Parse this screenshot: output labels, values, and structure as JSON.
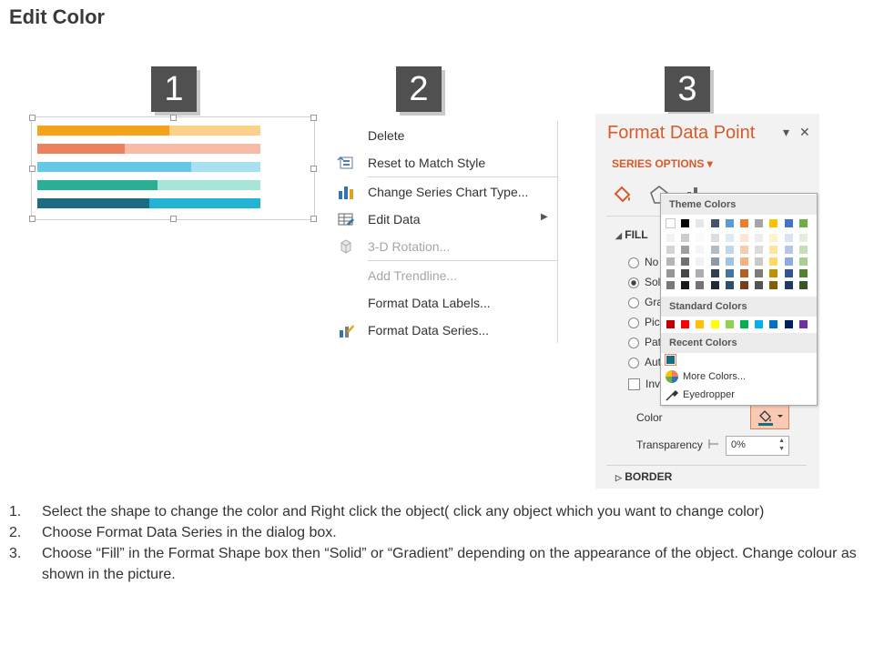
{
  "page": {
    "title": "Edit Color"
  },
  "steps": [
    "1",
    "2",
    "3"
  ],
  "chart_preview": {
    "bars": [
      {
        "light": "#fdd288",
        "dark": "#f4a21c",
        "fill": 0.59
      },
      {
        "light": "#f7bca8",
        "dark": "#e8825f",
        "fill": 0.39
      },
      {
        "light": "#a7e1f1",
        "dark": "#63c9e6",
        "fill": 0.69
      },
      {
        "light": "#a6e5d8",
        "dark": "#2aaf95",
        "fill": 0.54
      },
      {
        "light": "#22b4d5",
        "dark": "#1b6c80",
        "fill": 0.5
      }
    ]
  },
  "context_menu": {
    "items": [
      {
        "label": "Delete",
        "icon": "none",
        "disabled": false
      },
      {
        "label": "Reset to Match Style",
        "icon": "reset-style-icon",
        "disabled": false
      },
      {
        "label": "Change Series Chart Type...",
        "icon": "bar-chart-icon",
        "disabled": false
      },
      {
        "label": "Edit Data",
        "icon": "table-edit-icon",
        "disabled": false,
        "submenu": true
      },
      {
        "label": "3-D Rotation...",
        "icon": "cube-icon",
        "disabled": true
      },
      {
        "label": "Add Trendline...",
        "icon": "none",
        "disabled": true
      },
      {
        "label": "Format Data Labels...",
        "icon": "none",
        "disabled": false
      },
      {
        "label": "Format Data Series...",
        "icon": "format-series-icon",
        "disabled": false
      }
    ]
  },
  "format_pane": {
    "title": "Format Data Point",
    "series_options": "SERIES OPTIONS",
    "fill_section": "FILL",
    "fill_options": [
      "No",
      "Soli",
      "Gra",
      "Pict",
      "Pat",
      "Aut"
    ],
    "selected_fill": 1,
    "invert_label": "Inve",
    "color_label": "Color",
    "transparency_label": "Transparency",
    "transparency_value": "0%",
    "border_section": "BORDER"
  },
  "color_dropdown": {
    "theme_header": "Theme Colors",
    "standard_header": "Standard Colors",
    "recent_header": "Recent Colors",
    "theme_colors": [
      "#ffffff",
      "#000000",
      "#e7e6e6",
      "#44546a",
      "#5b9bd5",
      "#ed7d31",
      "#a5a5a5",
      "#ffc000",
      "#4472c4",
      "#70ad47"
    ],
    "standard_colors": [
      "#c00000",
      "#ff0000",
      "#ffc000",
      "#ffff00",
      "#92d050",
      "#00b050",
      "#00b0f0",
      "#0070c0",
      "#002060",
      "#7030a0"
    ],
    "recent_colors": [
      "#1b6c80"
    ],
    "more_colors": "More Colors...",
    "eyedropper": "Eyedropper"
  },
  "instructions": [
    {
      "num": "1.",
      "text": "Select the shape to change the color and Right click the object( click any object which you want to change color)"
    },
    {
      "num": "2.",
      "text": "Choose Format Data Series in the dialog box."
    },
    {
      "num": "3.",
      "text": "Choose “Fill” in the Format Shape box then “Solid” or “Gradient” depending on the appearance of the object. Change colour as shown in the picture."
    }
  ]
}
